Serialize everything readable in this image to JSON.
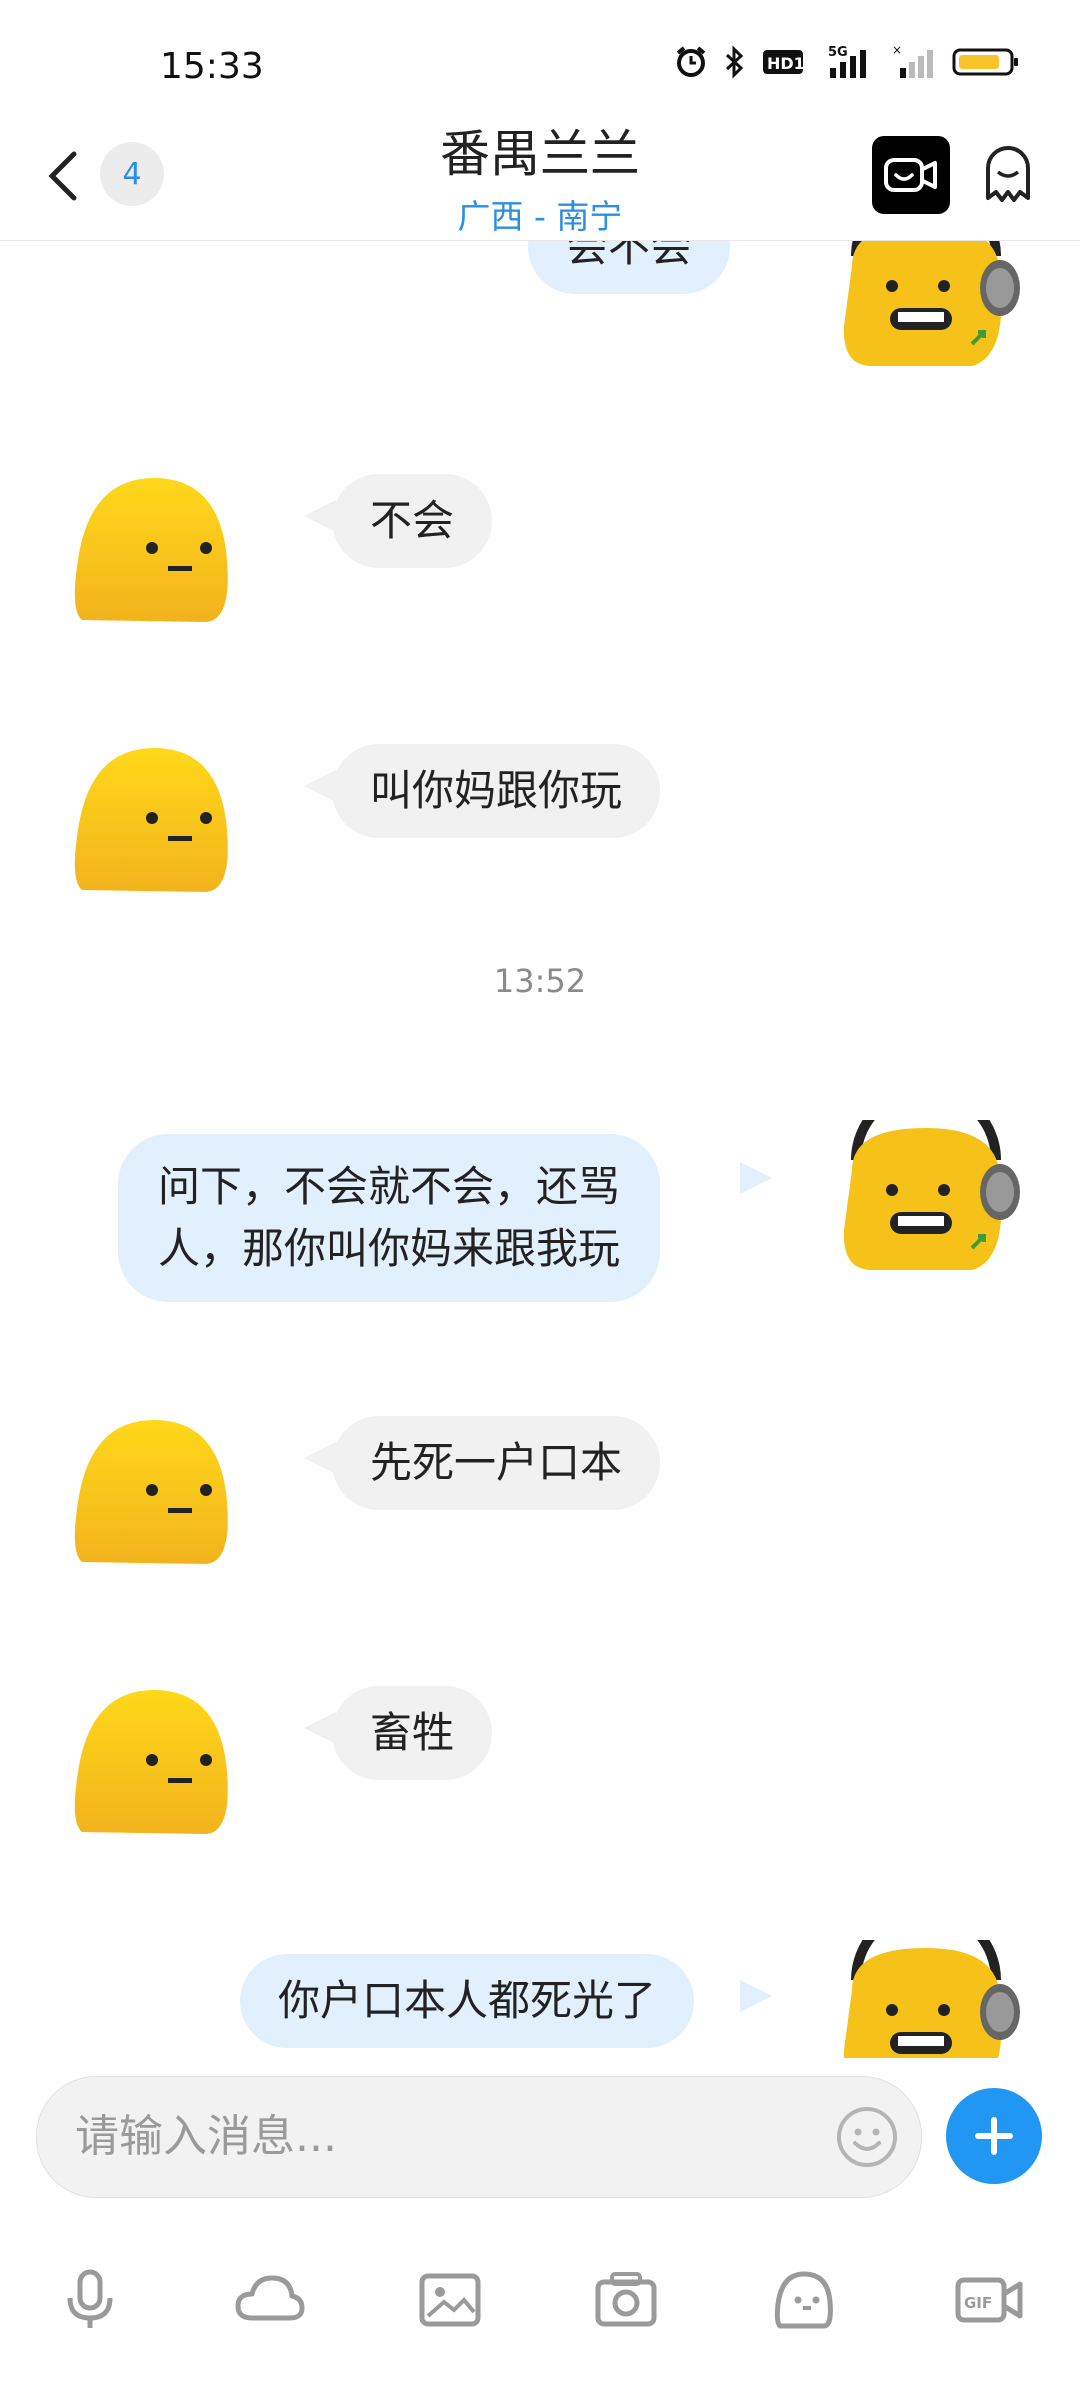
{
  "status": {
    "time": "15:33",
    "network": "5G",
    "hd_label": "HD1"
  },
  "header": {
    "back_label": "‹",
    "unread_count": "4",
    "title": "番禺兰兰",
    "subtitle": "广西 - 南宁"
  },
  "messages": [
    {
      "side": "out",
      "text": "会不会"
    },
    {
      "side": "in",
      "text": "不会"
    },
    {
      "side": "in",
      "text": "叫你妈跟你玩"
    },
    {
      "side": "time",
      "text": "13:52"
    },
    {
      "side": "out",
      "line1": "问下，不会就不会，还骂",
      "line2": "人，那你叫你妈来跟我玩"
    },
    {
      "side": "in",
      "text": "先死一户口本"
    },
    {
      "side": "in",
      "text": "畜牲"
    },
    {
      "side": "out",
      "text": "你户口本人都死光了"
    }
  ],
  "input": {
    "placeholder": "请输入消息..."
  },
  "toolbar": {
    "items": [
      "voice-icon",
      "cloud-icon",
      "image-icon",
      "camera-icon",
      "sticker-icon",
      "gif-icon"
    ]
  },
  "colors": {
    "accent": "#2196f3",
    "link": "#2b8fe0",
    "incoming_bubble": "#f1f1f1",
    "outgoing_bubble": "#e1f0fc",
    "avatar_yellow": "#f6c21a"
  }
}
